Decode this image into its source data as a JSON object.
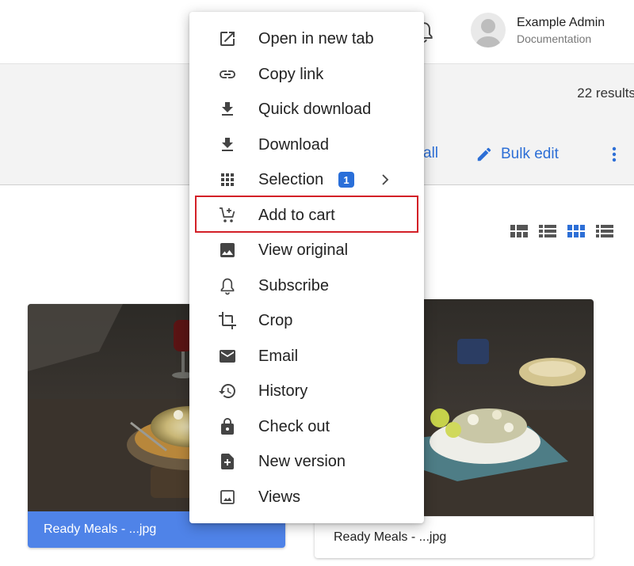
{
  "user": {
    "name": "Example Admin",
    "role": "Documentation"
  },
  "results": {
    "text": "22 results"
  },
  "actions": {
    "select_all_fragment": "all",
    "bulk_edit_label": "Bulk edit"
  },
  "context_menu": {
    "items": [
      {
        "label": "Open in new tab",
        "icon": "open-in-new-tab-icon"
      },
      {
        "label": "Copy link",
        "icon": "link-icon"
      },
      {
        "label": "Quick download",
        "icon": "download-icon"
      },
      {
        "label": "Download",
        "icon": "download-icon"
      },
      {
        "label": "Selection",
        "icon": "grid-icon",
        "badge": "1"
      },
      {
        "label": "Add to cart",
        "icon": "add-to-cart-icon",
        "highlighted": true
      },
      {
        "label": "View original",
        "icon": "image-icon"
      },
      {
        "label": "Subscribe",
        "icon": "bell-icon"
      },
      {
        "label": "Crop",
        "icon": "crop-icon"
      },
      {
        "label": "Email",
        "icon": "envelope-icon"
      },
      {
        "label": "History",
        "icon": "history-icon"
      },
      {
        "label": "Check out",
        "icon": "lock-icon"
      },
      {
        "label": "New version",
        "icon": "new-file-icon"
      },
      {
        "label": "Views",
        "icon": "views-icon"
      }
    ]
  },
  "cards": [
    {
      "caption": "Ready Meals - ...jpg",
      "selected": true
    },
    {
      "caption": "Ready Meals - ...jpg",
      "selected": false
    }
  ],
  "colors": {
    "accent": "#2d6fd6",
    "selected_caption": "#4f83e8",
    "highlight_border": "#d32027"
  }
}
